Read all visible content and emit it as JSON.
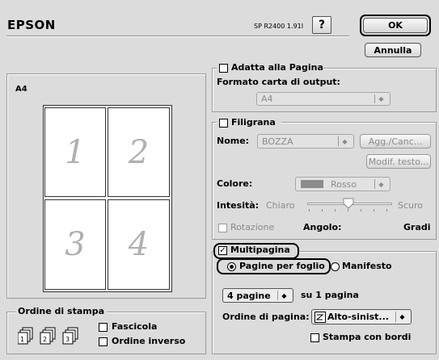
{
  "header": {
    "brand": "EPSON",
    "model": "SP R2400 1.91I",
    "help_glyph": "?",
    "ok_label": "OK",
    "cancel_label": "Annulla"
  },
  "preview": {
    "paper_size": "A4",
    "pages": [
      "1",
      "2",
      "3",
      "4"
    ]
  },
  "print_order": {
    "title": "Ordine di stampa",
    "collate_label": "Fascicola",
    "reverse_label": "Ordine inverso",
    "collate_checked": false,
    "reverse_checked": false,
    "icons": [
      "stack-1",
      "stack-2",
      "stack-3"
    ],
    "icon_numbers": [
      "1",
      "2",
      "3"
    ]
  },
  "fit_page": {
    "label": "Adatta alla Pagina",
    "checked": false,
    "output_label": "Formato carta di output:",
    "output_value": "A4"
  },
  "watermark": {
    "label": "Filigrana",
    "checked": false,
    "name_label": "Nome:",
    "name_value": "BOZZA",
    "add_delete_label": "Agg./Canc...",
    "edit_text_label": "Modif. testo...",
    "color_label": "Colore:",
    "color_value": "Rosso",
    "color_swatch": "#8c8c8c",
    "intensity_label": "Intesità:",
    "intensity_low": "Chiaro",
    "intensity_high": "Scuro",
    "intensity_level": 0.5,
    "rotation_label": "Rotazione",
    "angle_label": "Angolo:",
    "degrees_label": "Gradi"
  },
  "multipage": {
    "label": "Multipagina",
    "checked": true,
    "check_glyph": "✓",
    "pages_per_sheet_label": "Pagine per foglio",
    "poster_label": "Manifesto",
    "pages_value": "4 pagine",
    "pages_suffix": "su 1 pagina",
    "page_order_label": "Ordine di pagina:",
    "page_order_value": "Alto-sinist...",
    "borders_label": "Stampa con bordi",
    "borders_checked": false
  }
}
